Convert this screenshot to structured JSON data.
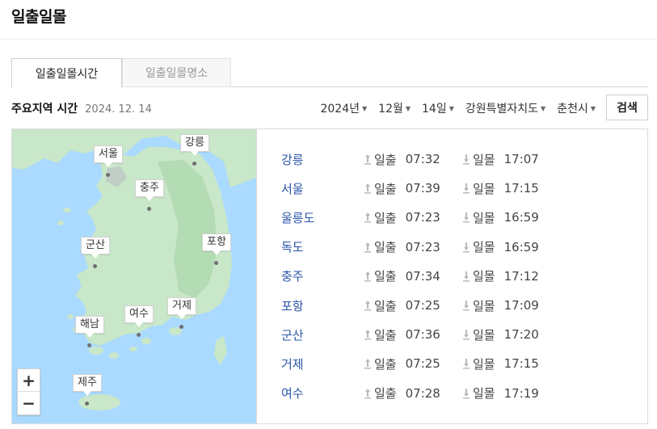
{
  "page": {
    "title": "일출일몰"
  },
  "tabs": [
    {
      "label": "일출일몰시간",
      "active": true
    },
    {
      "label": "일출일몰명소",
      "active": false
    }
  ],
  "subheader": {
    "label": "주요지역 시간",
    "date": "2024. 12. 14"
  },
  "filters": {
    "year": "2024년",
    "month": "12월",
    "day": "14일",
    "province": "강원특별자치도",
    "city": "춘천시",
    "search_label": "검색"
  },
  "map": {
    "pins": [
      "강릉",
      "서울",
      "충주",
      "군산",
      "포항",
      "여수",
      "거제",
      "해남",
      "제주"
    ],
    "zoom_in": "+",
    "zoom_out": "−"
  },
  "list": {
    "sunrise_word": "일출",
    "sunset_word": "일몰",
    "rows": [
      {
        "city": "강릉",
        "sunrise": "07:32",
        "sunset": "17:07"
      },
      {
        "city": "서울",
        "sunrise": "07:39",
        "sunset": "17:15"
      },
      {
        "city": "울릉도",
        "sunrise": "07:23",
        "sunset": "16:59"
      },
      {
        "city": "독도",
        "sunrise": "07:23",
        "sunset": "16:59"
      },
      {
        "city": "충주",
        "sunrise": "07:34",
        "sunset": "17:12"
      },
      {
        "city": "포항",
        "sunrise": "07:25",
        "sunset": "17:09"
      },
      {
        "city": "군산",
        "sunrise": "07:36",
        "sunset": "17:20"
      },
      {
        "city": "거제",
        "sunrise": "07:25",
        "sunset": "17:15"
      },
      {
        "city": "여수",
        "sunrise": "07:28",
        "sunset": "17:19"
      }
    ]
  },
  "colors": {
    "city_link": "#2a55a8",
    "sea": "#aadaff",
    "land": "#c9e7c9"
  }
}
